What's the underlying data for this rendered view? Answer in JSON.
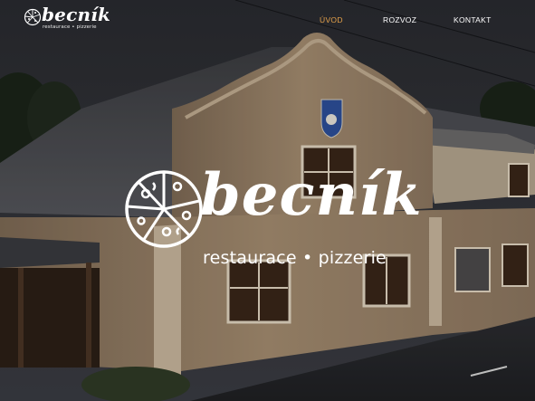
{
  "brand": {
    "name": "becník",
    "tagline": "restaurace • pizzerie"
  },
  "nav": {
    "items": [
      {
        "label": "ÚVOD",
        "active": true
      },
      {
        "label": "ROZVOZ",
        "active": false
      },
      {
        "label": "KONTAKT",
        "active": false
      }
    ]
  },
  "hero": {
    "logo_name": "becník",
    "logo_tagline": "restaurace • pizzerie",
    "background": "restaurant-building-photo",
    "emblem_icon": "pizza-slice-icon"
  },
  "colors": {
    "accent": "#e5a24a",
    "text": "#ffffff",
    "facade": "#a88c6c",
    "roof": "#4a4b4f"
  }
}
